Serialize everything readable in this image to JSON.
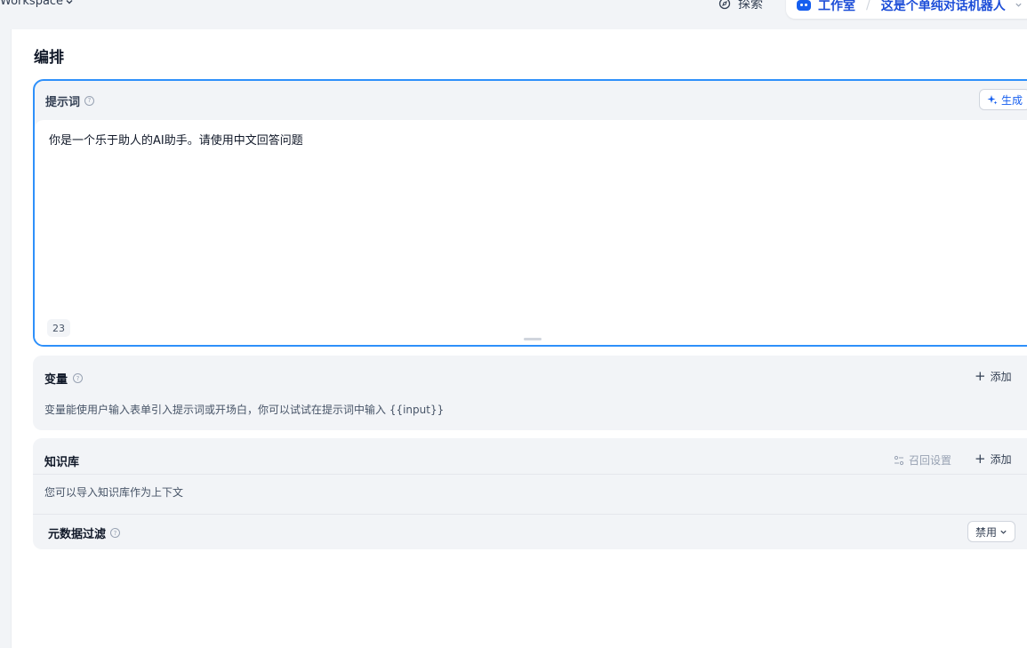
{
  "topbar": {
    "workspace_label": "Workspace",
    "explore_label": "探索",
    "studio_label": "工作室",
    "app_name": "这是个单纯对话机器人"
  },
  "main": {
    "section_title": "编排",
    "prompt": {
      "title": "提示词",
      "generate_label": "生成",
      "text": "你是一个乐于助人的AI助手。请使用中文回答问题",
      "char_count": "23"
    },
    "variables": {
      "title": "变量",
      "add_label": "添加",
      "description": "变量能使用户输入表单引入提示词或开场白，你可以试试在提示词中输入 {{input}}"
    },
    "knowledge": {
      "title": "知识库",
      "recall_label": "召回设置",
      "add_label": "添加",
      "description": "您可以导入知识库作为上下文",
      "metadata_filter_label": "元数据过滤",
      "metadata_filter_value": "禁用"
    }
  },
  "colors": {
    "accent": "#155eef",
    "focus_border": "#2e90fa"
  }
}
